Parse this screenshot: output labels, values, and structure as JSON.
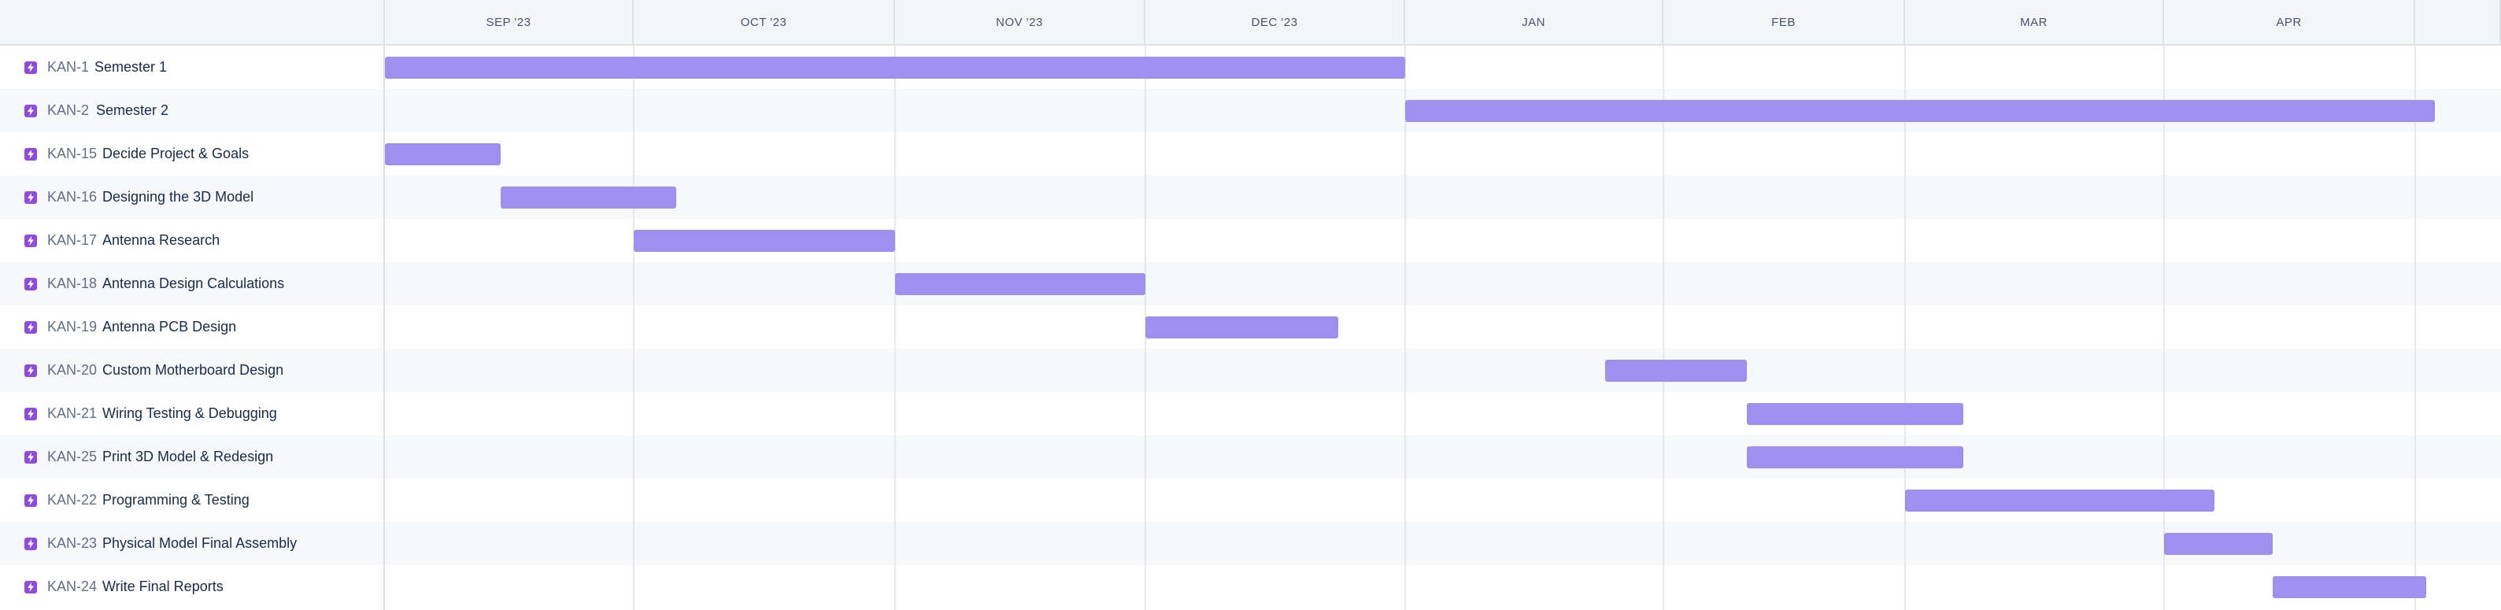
{
  "timeline": {
    "months": [
      "SEP '23",
      "OCT '23",
      "NOV '23",
      "DEC '23",
      "JAN",
      "FEB",
      "MAR",
      "APR",
      ""
    ]
  },
  "colors": {
    "bar": "#9f8fef",
    "type_icon": "#8f4ae0",
    "row_alt": "#f7f8f9",
    "header_bg": "#f4f5f7"
  },
  "issues": [
    {
      "key": "KAN-1",
      "summary": "Semester 1",
      "type_icon": "subtask-icon"
    },
    {
      "key": "KAN-2",
      "summary": "Semester 2",
      "type_icon": "subtask-icon"
    },
    {
      "key": "KAN-15",
      "summary": "Decide Project & Goals",
      "type_icon": "subtask-icon"
    },
    {
      "key": "KAN-16",
      "summary": "Designing the 3D Model",
      "type_icon": "subtask-icon"
    },
    {
      "key": "KAN-17",
      "summary": "Antenna Research",
      "type_icon": "subtask-icon"
    },
    {
      "key": "KAN-18",
      "summary": "Antenna Design Calculations",
      "type_icon": "subtask-icon"
    },
    {
      "key": "KAN-19",
      "summary": "Antenna PCB Design",
      "type_icon": "subtask-icon"
    },
    {
      "key": "KAN-20",
      "summary": "Custom Motherboard Design",
      "type_icon": "subtask-icon"
    },
    {
      "key": "KAN-21",
      "summary": "Wiring Testing & Debugging",
      "type_icon": "subtask-icon"
    },
    {
      "key": "KAN-25",
      "summary": "Print 3D Model & Redesign",
      "type_icon": "subtask-icon"
    },
    {
      "key": "KAN-22",
      "summary": "Programming & Testing",
      "type_icon": "subtask-icon"
    },
    {
      "key": "KAN-23",
      "summary": "Physical Model Final Assembly",
      "type_icon": "subtask-icon"
    },
    {
      "key": "KAN-24",
      "summary": "Write Final Reports",
      "type_icon": "subtask-icon"
    }
  ],
  "chart_data": {
    "type": "gantt",
    "x_axis": "time",
    "categories": [
      "SEP '23",
      "OCT '23",
      "NOV '23",
      "DEC '23",
      "JAN",
      "FEB",
      "MAR",
      "APR"
    ],
    "tasks": [
      {
        "key": "KAN-1",
        "name": "Semester 1",
        "start": "2023-09-01",
        "end": "2024-01-01"
      },
      {
        "key": "KAN-2",
        "name": "Semester 2",
        "start": "2024-01-01",
        "end": "2024-05-08"
      },
      {
        "key": "KAN-15",
        "name": "Decide Project & Goals",
        "start": "2023-09-01",
        "end": "2023-09-15"
      },
      {
        "key": "KAN-16",
        "name": "Designing the 3D Model",
        "start": "2023-09-15",
        "end": "2023-10-06"
      },
      {
        "key": "KAN-17",
        "name": "Antenna Research",
        "start": "2023-10-01",
        "end": "2023-11-01"
      },
      {
        "key": "KAN-18",
        "name": "Antenna Design Calculations",
        "start": "2023-11-01",
        "end": "2023-12-01"
      },
      {
        "key": "KAN-19",
        "name": "Antenna PCB Design",
        "start": "2023-12-01",
        "end": "2023-12-24"
      },
      {
        "key": "KAN-20",
        "name": "Custom Motherboard Design",
        "start": "2024-01-25",
        "end": "2024-02-11"
      },
      {
        "key": "KAN-21",
        "name": "Wiring Testing & Debugging",
        "start": "2024-02-11",
        "end": "2024-03-08"
      },
      {
        "key": "KAN-25",
        "name": "Print 3D Model & Redesign",
        "start": "2024-02-11",
        "end": "2024-03-08"
      },
      {
        "key": "KAN-22",
        "name": "Programming & Testing",
        "start": "2024-03-01",
        "end": "2024-04-07"
      },
      {
        "key": "KAN-23",
        "name": "Physical Model Final Assembly",
        "start": "2024-04-01",
        "end": "2024-04-14"
      },
      {
        "key": "KAN-24",
        "name": "Write Final Reports",
        "start": "2024-04-14",
        "end": "2024-05-05"
      }
    ]
  }
}
